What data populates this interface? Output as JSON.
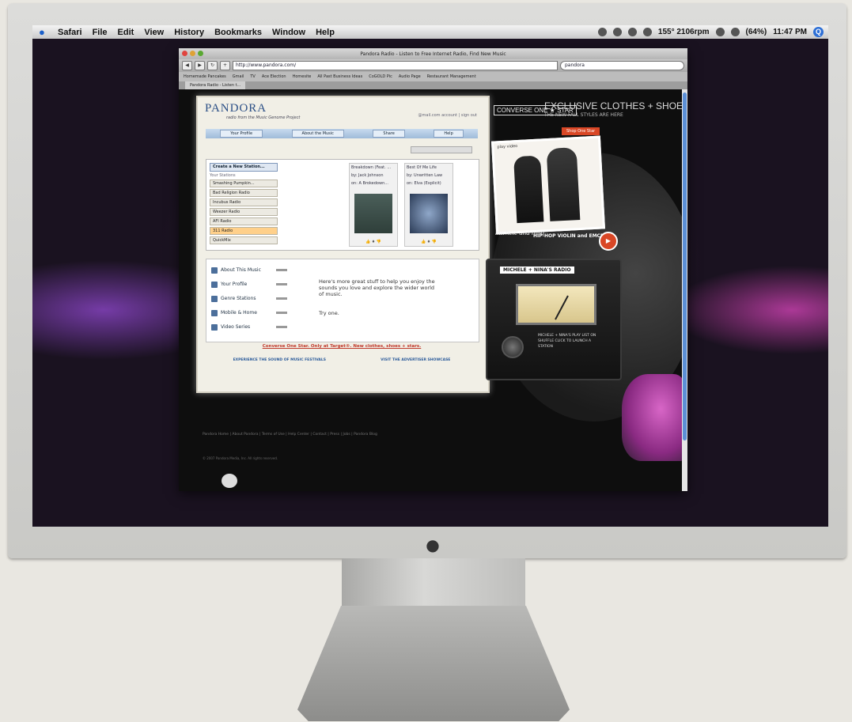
{
  "menubar": {
    "items": [
      "Safari",
      "File",
      "Edit",
      "View",
      "History",
      "Bookmarks",
      "Window",
      "Help"
    ],
    "status": "155° 2106rpm",
    "battery": "(64%)",
    "time": "11:47 PM"
  },
  "browser": {
    "title": "Pandora Radio - Listen to Free Internet Radio, Find New Music",
    "url": "http://www.pandora.com/",
    "search": "pandora",
    "bookmarks": [
      "Homemade Pancakes",
      "Gmail",
      "TV",
      "Ace Election",
      "Homesite",
      "All Past Business Ideas",
      "CoGOLD Pic",
      "Audio Page",
      "Restaurant Management"
    ],
    "tab": "Pandora Radio - Listen t..."
  },
  "pandora": {
    "logo": "PANDORA",
    "tagline": "radio from the Music Genome Project",
    "user": "@mail.com   account  |  sign out",
    "nav": [
      "Your Profile",
      "About the Music",
      "Share",
      "Help"
    ],
    "create_station": "Create a New Station...",
    "your_stations": "Your Stations",
    "stations": [
      "Smashing Pumpkin...",
      "Bad Religion Radio",
      "Incubus Radio",
      "Weezer Radio",
      "AFI Radio",
      "311 Radio",
      "QuickMix"
    ],
    "track1": {
      "title": "Breakdown (Feat. ...",
      "by": "by: Jack Johnson",
      "on": "on: A Brokedown..."
    },
    "track2": {
      "title": "Best Of Me Life",
      "by": "by: Unwritten Law",
      "on": "on: Elva (Explicit)"
    },
    "links": [
      "About This Music",
      "Your Profile",
      "Genre Stations",
      "Mobile & Home",
      "Video Series"
    ],
    "more_text": "Here's more great stuff to help you enjoy the sounds you love and explore the wider world of music.",
    "try": "Try one.",
    "promo": "Converse One Star. Only at Target®. New clothes, shoes + stars.",
    "footer_left": "EXPERIENCE THE SOUND OF MUSIC FESTIVALS",
    "footer_right": "VISIT THE ADVERTISER SHOWCASE"
  },
  "ad": {
    "logo": "CONVERSE ONE ★ STAR",
    "title": "EXCLUSIVE CLOTHES + SHOES",
    "sub": "THE NEW FALL STYLES ARE HERE",
    "shop": "Shop One Star",
    "photo_caption": "play video",
    "hh_script": "michele and nina",
    "hh_text": "HIP-HOP VIOLIN and EMCEE",
    "radio_label": "MICHELE + NINA'S RADIO",
    "radio_text": "MICHELE + NINA'S PLAY LIST ON SHUFFLE CLICK TO LAUNCH A STATION"
  },
  "site_footer": "Pandora Home  |  About Pandora  |  Terms of Use  |  Help Center  |  Contact  |  Press  |  Jobs  |  Pandora Blog",
  "copyright": "© 2007 Pandora Media, Inc. All rights reserved."
}
